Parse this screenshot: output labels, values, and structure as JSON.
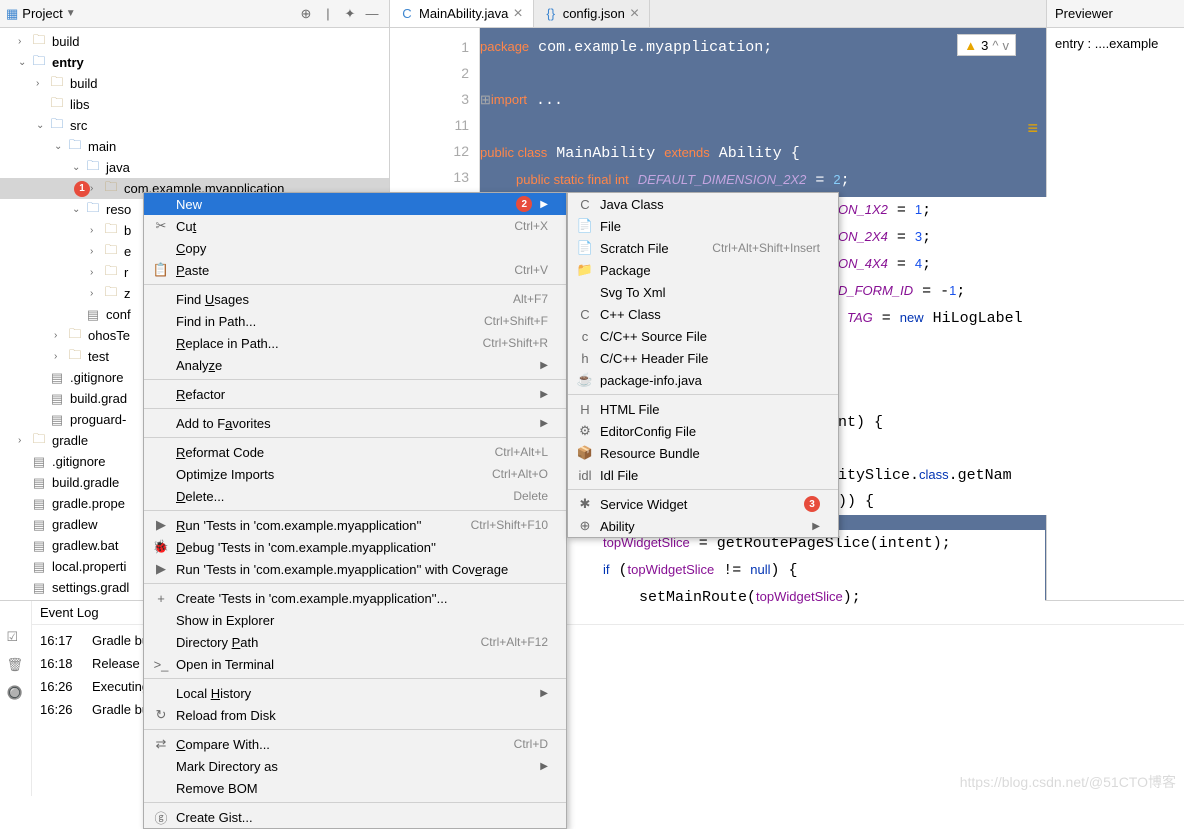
{
  "project_panel": {
    "title": "Project",
    "tree": [
      {
        "indent": 0,
        "arrow": ">",
        "icon": "folder",
        "label": "build"
      },
      {
        "indent": 0,
        "arrow": "v",
        "icon": "folder-blue",
        "label": "entry",
        "bold": true
      },
      {
        "indent": 1,
        "arrow": ">",
        "icon": "folder",
        "label": "build"
      },
      {
        "indent": 1,
        "arrow": "",
        "icon": "folder",
        "label": "libs"
      },
      {
        "indent": 1,
        "arrow": "v",
        "icon": "folder-blue",
        "label": "src"
      },
      {
        "indent": 2,
        "arrow": "v",
        "icon": "folder-blue",
        "label": "main"
      },
      {
        "indent": 3,
        "arrow": "v",
        "icon": "folder-blue",
        "label": "java"
      },
      {
        "indent": 4,
        "arrow": ">",
        "icon": "folder",
        "label": "com.example.myapplication",
        "selected": true,
        "badge": "1"
      },
      {
        "indent": 3,
        "arrow": "v",
        "icon": "folder-blue",
        "label": "reso"
      },
      {
        "indent": 4,
        "arrow": ">",
        "icon": "folder",
        "label": "b"
      },
      {
        "indent": 4,
        "arrow": ">",
        "icon": "folder",
        "label": "e"
      },
      {
        "indent": 4,
        "arrow": ">",
        "icon": "folder",
        "label": "r"
      },
      {
        "indent": 4,
        "arrow": ">",
        "icon": "folder",
        "label": "z"
      },
      {
        "indent": 3,
        "arrow": "",
        "icon": "file",
        "label": "conf"
      },
      {
        "indent": 2,
        "arrow": ">",
        "icon": "folder",
        "label": "ohosTe"
      },
      {
        "indent": 2,
        "arrow": ">",
        "icon": "folder",
        "label": "test"
      },
      {
        "indent": 1,
        "arrow": "",
        "icon": "file",
        "label": ".gitignore"
      },
      {
        "indent": 1,
        "arrow": "",
        "icon": "file",
        "label": "build.grad"
      },
      {
        "indent": 1,
        "arrow": "",
        "icon": "file",
        "label": "proguard-"
      },
      {
        "indent": 0,
        "arrow": ">",
        "icon": "folder",
        "label": "gradle"
      },
      {
        "indent": 0,
        "arrow": "",
        "icon": "file",
        "label": ".gitignore"
      },
      {
        "indent": 0,
        "arrow": "",
        "icon": "file",
        "label": "build.gradle"
      },
      {
        "indent": 0,
        "arrow": "",
        "icon": "file",
        "label": "gradle.prope"
      },
      {
        "indent": 0,
        "arrow": "",
        "icon": "file",
        "label": "gradlew"
      },
      {
        "indent": 0,
        "arrow": "",
        "icon": "file",
        "label": "gradlew.bat"
      },
      {
        "indent": 0,
        "arrow": "",
        "icon": "file",
        "label": "local.properti"
      },
      {
        "indent": 0,
        "arrow": "",
        "icon": "file",
        "label": "settings.gradl"
      }
    ]
  },
  "tabs": [
    {
      "icon": "C",
      "label": "MainAbility.java",
      "active": true
    },
    {
      "icon": "{}",
      "label": "config.json",
      "active": false
    }
  ],
  "gutter_lines": [
    "1",
    "2",
    "3",
    "11",
    "12",
    "13"
  ],
  "warnings": {
    "count": "3"
  },
  "previewer": {
    "title": "Previewer",
    "text": "entry : ....example"
  },
  "eventlog": {
    "title": "Event Log",
    "rows": [
      {
        "time": "16:17",
        "text": "Gradle buil"
      },
      {
        "time": "16:18",
        "text": "Release rem"
      },
      {
        "time": "16:26",
        "text": "Executing ta"
      },
      {
        "time": "16:26",
        "text": "Gradle buil"
      }
    ]
  },
  "context_menu": [
    {
      "label": "New",
      "selected": true,
      "arrow": true,
      "badge": "2"
    },
    {
      "icon": "✂",
      "label": "Cut",
      "shortcut": "Ctrl+X",
      "u": [
        2
      ]
    },
    {
      "label": "Copy",
      "u": [
        0
      ]
    },
    {
      "icon": "📋",
      "label": "Paste",
      "shortcut": "Ctrl+V",
      "u": [
        0
      ]
    },
    {
      "sep": true
    },
    {
      "label": "Find Usages",
      "shortcut": "Alt+F7",
      "u": [
        5
      ]
    },
    {
      "label": "Find in Path...",
      "shortcut": "Ctrl+Shift+F"
    },
    {
      "label": "Replace in Path...",
      "shortcut": "Ctrl+Shift+R",
      "u": [
        0
      ]
    },
    {
      "label": "Analyze",
      "arrow": true,
      "u": [
        5
      ]
    },
    {
      "sep": true
    },
    {
      "label": "Refactor",
      "arrow": true,
      "u": [
        0
      ]
    },
    {
      "sep": true
    },
    {
      "label": "Add to Favorites",
      "arrow": true,
      "u": [
        8
      ]
    },
    {
      "sep": true
    },
    {
      "label": "Reformat Code",
      "shortcut": "Ctrl+Alt+L",
      "u": [
        0
      ]
    },
    {
      "label": "Optimize Imports",
      "shortcut": "Ctrl+Alt+O",
      "u": [
        5
      ]
    },
    {
      "label": "Delete...",
      "shortcut": "Delete",
      "u": [
        0
      ]
    },
    {
      "sep": true
    },
    {
      "icon": "▶",
      "label": "Run 'Tests in 'com.example.myapplication''",
      "shortcut": "Ctrl+Shift+F10",
      "u": [
        0
      ]
    },
    {
      "icon": "🐞",
      "label": "Debug 'Tests in 'com.example.myapplication''",
      "u": [
        0
      ]
    },
    {
      "icon": "▶",
      "label": "Run 'Tests in 'com.example.myapplication'' with Coverage",
      "u": [
        51
      ]
    },
    {
      "sep": true
    },
    {
      "icon": "+",
      "label": "Create 'Tests in 'com.example.myapplication''..."
    },
    {
      "label": "Show in Explorer"
    },
    {
      "label": "Directory Path",
      "shortcut": "Ctrl+Alt+F12",
      "u": [
        10
      ]
    },
    {
      "icon": ">_",
      "label": "Open in Terminal"
    },
    {
      "sep": true
    },
    {
      "label": "Local History",
      "arrow": true,
      "u": [
        6
      ]
    },
    {
      "icon": "↻",
      "label": "Reload from Disk"
    },
    {
      "sep": true
    },
    {
      "icon": "⇄",
      "label": "Compare With...",
      "shortcut": "Ctrl+D",
      "u": [
        0
      ]
    },
    {
      "label": "Mark Directory as",
      "arrow": true
    },
    {
      "label": "Remove BOM"
    },
    {
      "sep": true
    },
    {
      "icon": "ⓖ",
      "label": "Create Gist..."
    }
  ],
  "submenu": [
    {
      "icon": "C",
      "label": "Java Class"
    },
    {
      "icon": "📄",
      "label": "File"
    },
    {
      "icon": "📄",
      "label": "Scratch File",
      "shortcut": "Ctrl+Alt+Shift+Insert"
    },
    {
      "icon": "📁",
      "label": "Package"
    },
    {
      "label": "Svg To Xml"
    },
    {
      "icon": "C",
      "label": "C++ Class"
    },
    {
      "icon": "c",
      "label": "C/C++ Source File"
    },
    {
      "icon": "h",
      "label": "C/C++ Header File"
    },
    {
      "icon": "☕",
      "label": "package-info.java"
    },
    {
      "sep": true
    },
    {
      "icon": "H",
      "label": "HTML File"
    },
    {
      "icon": "⚙",
      "label": "EditorConfig File"
    },
    {
      "icon": "📦",
      "label": "Resource Bundle"
    },
    {
      "icon": "idl",
      "label": "Idl File"
    },
    {
      "sep": true
    },
    {
      "icon": "✱",
      "label": "Service Widget",
      "badge": "3",
      "u": [
        14
      ]
    },
    {
      "icon": "⊕",
      "label": "Ability",
      "arrow": true
    }
  ],
  "watermark": "https://blog.csdn.net/@51CTO博客"
}
